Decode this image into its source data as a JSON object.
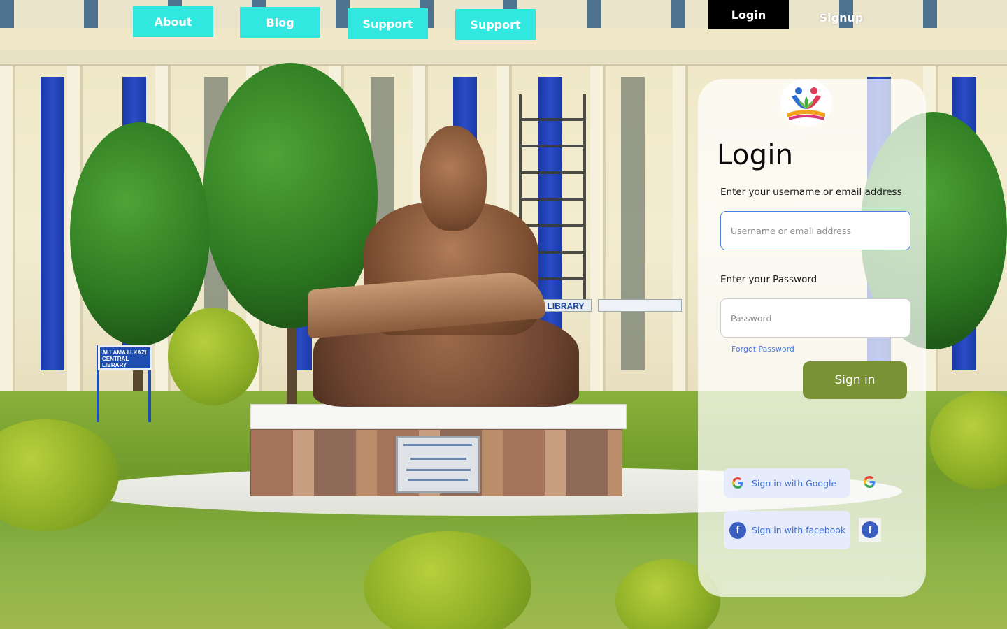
{
  "nav": {
    "items": [
      {
        "label": "About"
      },
      {
        "label": "Blog"
      },
      {
        "label": "Support"
      },
      {
        "label": "Support"
      }
    ],
    "login_label": "Login",
    "signup_label": "Signup"
  },
  "background": {
    "library_sign": "LIBRARY",
    "campus_sign": "ALLAMA I.I.KAZI CENTRAL LIBRARY",
    "plaque_title": "UNIVERSITY OF SINDH",
    "plaque_subtitle": "STATUE OF WISDOM"
  },
  "login_card": {
    "title": "Login",
    "username_label": "Enter your username or email address",
    "username_placeholder": "Username or email address",
    "username_value": "",
    "password_label": "Enter your Password",
    "password_placeholder": "Password",
    "password_value": "",
    "forgot_password": "Forgot Password",
    "sign_in_label": "Sign in",
    "google_label": "Sign in with Google",
    "facebook_label": "Sign in with facebook"
  },
  "colors": {
    "nav_button": "#32e7e0",
    "login_active": "#000000",
    "sign_in_button": "#789235",
    "link": "#4b78d6",
    "social_bg": "#e6ecfb"
  },
  "icons": {
    "logo": "community-logo-icon",
    "google": "google-icon",
    "facebook": "facebook-icon"
  }
}
